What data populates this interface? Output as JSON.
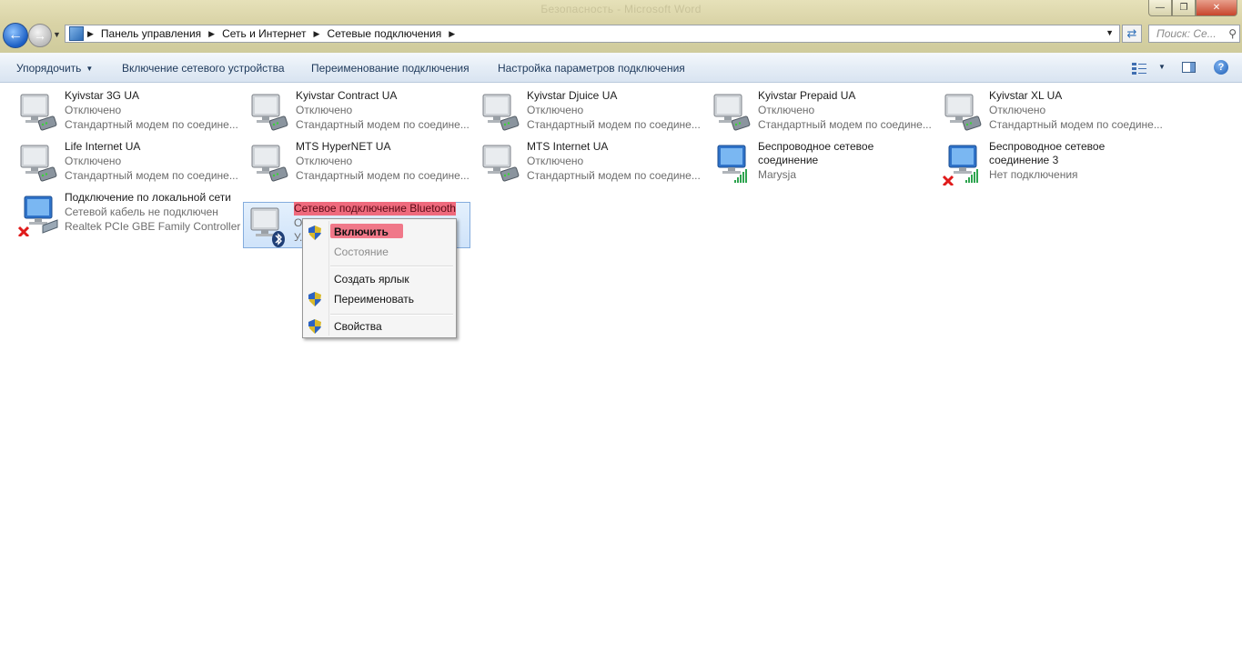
{
  "window": {
    "title": "Безопасность - Microsoft Word"
  },
  "address": {
    "crumbs": [
      "Панель управления",
      "Сеть и Интернет",
      "Сетевые подключения"
    ],
    "search_placeholder": "Поиск: Се..."
  },
  "toolbar": {
    "organize": "Упорядочить",
    "enable_device": "Включение сетевого устройства",
    "rename": "Переименование подключения",
    "settings": "Настройка параметров подключения"
  },
  "connections": [
    {
      "name": "Kyivstar 3G UA",
      "status": "Отключено",
      "device": "Стандартный модем по соедине...",
      "type": "modem"
    },
    {
      "name": "Kyivstar Contract UA",
      "status": "Отключено",
      "device": "Стандартный модем по соедине...",
      "type": "modem"
    },
    {
      "name": "Kyivstar Djuice UA",
      "status": "Отключено",
      "device": "Стандартный модем по соедине...",
      "type": "modem"
    },
    {
      "name": "Kyivstar Prepaid UA",
      "status": "Отключено",
      "device": "Стандартный модем по соедине...",
      "type": "modem"
    },
    {
      "name": "Kyivstar XL UA",
      "status": "Отключено",
      "device": "Стандартный модем по соедине...",
      "type": "modem"
    },
    {
      "name": "Life Internet UA",
      "status": "Отключено",
      "device": "Стандартный модем по соедине...",
      "type": "modem"
    },
    {
      "name": "MTS HyperNET UA",
      "status": "Отключено",
      "device": "Стандартный модем по соедине...",
      "type": "modem"
    },
    {
      "name": "MTS Internet UA",
      "status": "Отключено",
      "device": "Стандартный модем по соедине...",
      "type": "modem"
    },
    {
      "name": "Беспроводное сетевое соединение",
      "status": "Marysja",
      "device": "",
      "type": "wireless"
    },
    {
      "name": "Беспроводное сетевое соединение 3",
      "status": "Нет подключения",
      "device": "",
      "type": "wireless-off"
    },
    {
      "name": "Подключение по локальной сети",
      "status": "Сетевой кабель не подключен",
      "device": "Realtek PCIe GBE Family Controller",
      "type": "lan-off"
    },
    {
      "name": "Сетевое подключение Bluetooth",
      "status": "Отключено",
      "device": "У...",
      "type": "bluetooth"
    }
  ],
  "context_menu": {
    "enable": "Включить",
    "status": "Состояние",
    "create_shortcut": "Создать ярлык",
    "rename": "Переименовать",
    "properties": "Свойства"
  },
  "colors": {
    "highlight": "#ef6a7d",
    "toolbar_text": "#1e395b",
    "selection_bg": "#cfe3fa"
  }
}
